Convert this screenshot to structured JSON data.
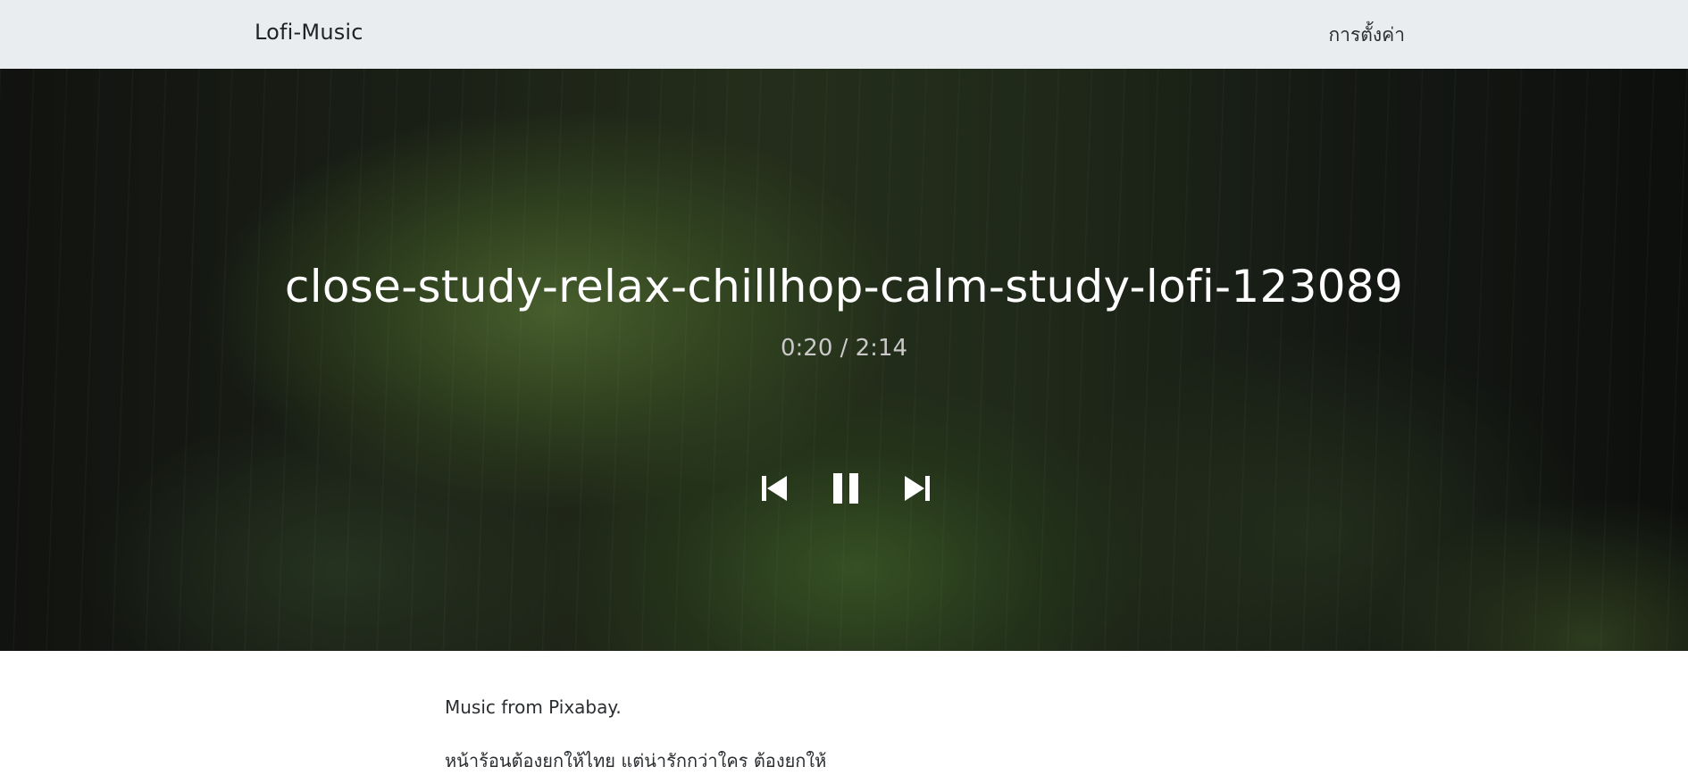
{
  "navbar": {
    "brand": "Lofi-Music",
    "settings_label": "การตั้งค่า"
  },
  "player": {
    "track_title": "close-study-relax-chillhop-calm-study-lofi-123089",
    "current_time": "0:20",
    "duration": "2:14",
    "time_display": "0:20 / 2:14",
    "controls": {
      "previous_icon": "skip-previous-icon",
      "pause_icon": "pause-icon",
      "next_icon": "skip-next-icon"
    }
  },
  "content": {
    "credit": "Music from Pixabay.",
    "proverb": "หน้าร้อนต้องยกให้ไทย แต่น่ารักกว่าใคร ต้องยกให้"
  },
  "colors": {
    "navbar_bg": "#e9edf0",
    "title_text": "#ffffff",
    "time_text": "#c9c9c9",
    "body_text": "#2a2e31"
  }
}
